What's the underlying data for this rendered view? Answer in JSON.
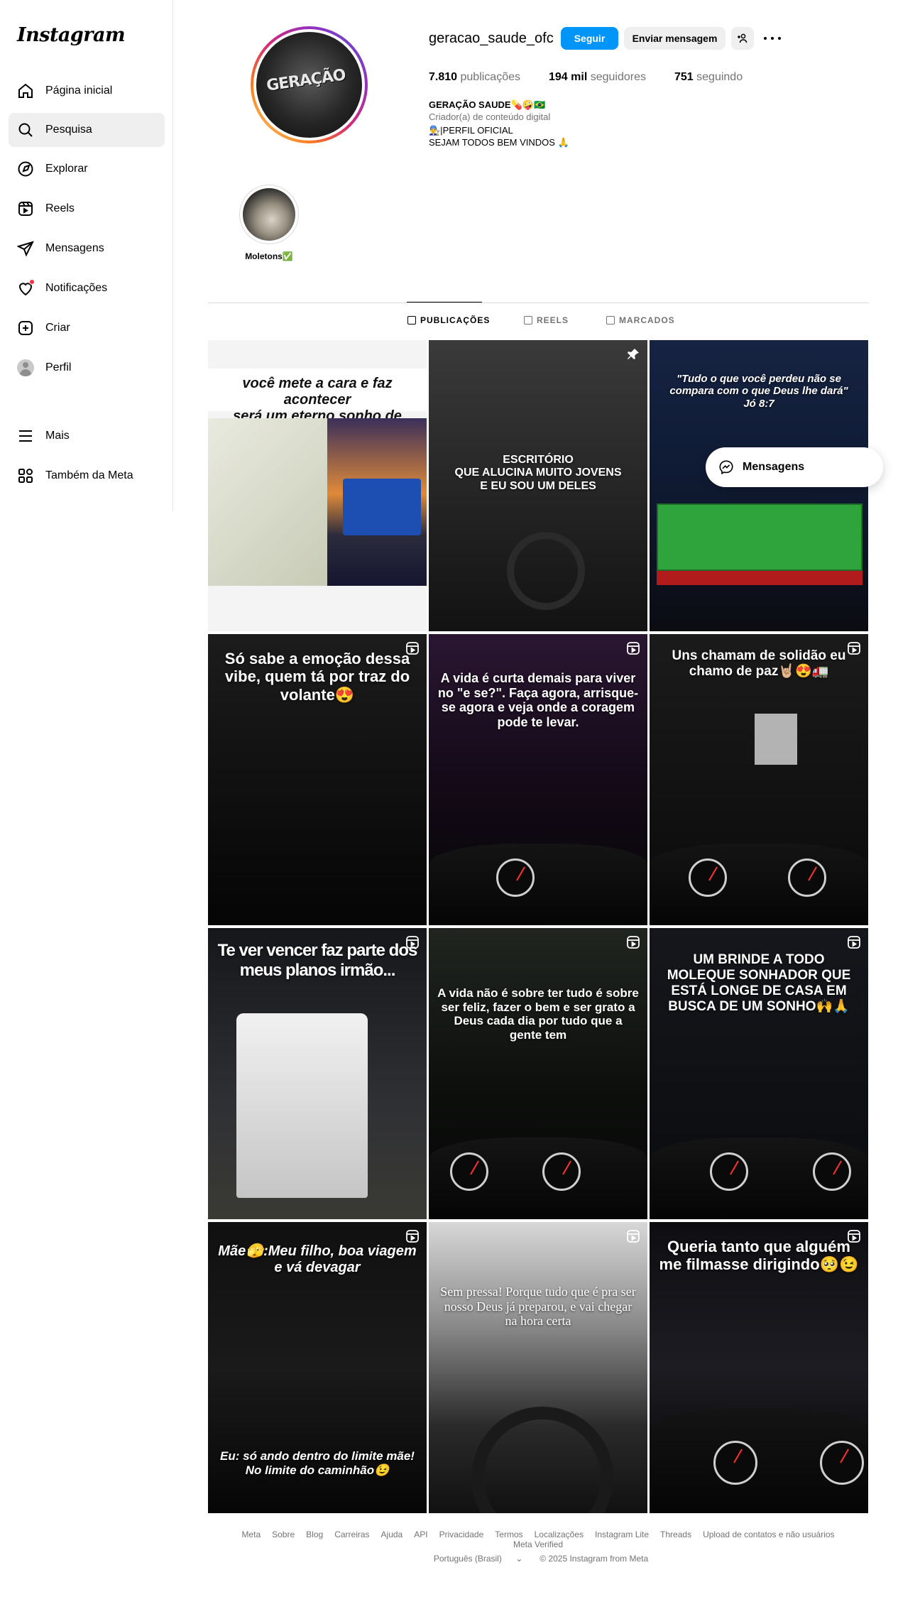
{
  "sidebar": {
    "logo": "Instagram",
    "items": [
      {
        "label": "Página inicial",
        "icon": "home-icon"
      },
      {
        "label": "Pesquisa",
        "icon": "search-icon"
      },
      {
        "label": "Explorar",
        "icon": "compass-icon"
      },
      {
        "label": "Reels",
        "icon": "reels-icon"
      },
      {
        "label": "Mensagens",
        "icon": "send-icon"
      },
      {
        "label": "Notificações",
        "icon": "heart-icon"
      },
      {
        "label": "Criar",
        "icon": "plus-icon"
      },
      {
        "label": "Perfil",
        "icon": "avatar-icon"
      },
      {
        "label": "Mais",
        "icon": "menu-icon"
      },
      {
        "label": "Também da Meta",
        "icon": "meta-apps-icon"
      }
    ]
  },
  "profile": {
    "username": "geracao_saude_ofc",
    "follow_label": "Seguir",
    "message_label": "Enviar mensagem",
    "avatar_text": "GERAÇÃO",
    "stats": {
      "posts_num": "7.810",
      "posts_label": "publicações",
      "followers_num": "194 mil",
      "followers_label": "seguidores",
      "following_num": "751",
      "following_label": "seguindo"
    },
    "bio": {
      "name": "GERAÇÃO SAUDE💊🤪🇧🇷",
      "category": "Criador(a) de conteúdo digital",
      "line1": "👨‍🔧|PERFIL OFICIAL",
      "line2": "SEJAM TODOS BEM VINDOS 🙏"
    }
  },
  "highlight": {
    "label": "Moletons✅"
  },
  "tabs": [
    {
      "label": "PUBLICAÇÕES",
      "icon": "grid-icon",
      "active": true
    },
    {
      "label": "REELS",
      "icon": "reels-icon",
      "active": false
    },
    {
      "label": "MARCADOS",
      "icon": "tagged-icon",
      "active": false
    }
  ],
  "posts": [
    {
      "caption": "você mete a cara e faz acontecer\nserá um eterno sonho de criança",
      "corner": "none"
    },
    {
      "caption": "ESCRITÓRIO\nQUE ALUCINA MUITO JOVENS\nE EU SOU UM DELES",
      "corner": "pin-icon"
    },
    {
      "caption": "\"Tudo o que você perdeu não se compara com o que Deus lhe dará\"\nJó 8:7",
      "corner": "none"
    },
    {
      "caption": "Só sabe a emoção dessa vibe, quem tá por traz do volante😍",
      "corner": "reel-icon"
    },
    {
      "caption": "A vida é curta demais para viver no \"e se?\". Faça agora, arrisque-se agora e veja onde a coragem pode te levar.",
      "corner": "reel-icon"
    },
    {
      "caption": "Uns chamam de solidão eu chamo de paz🤘🏼😍🚛",
      "corner": "reel-icon"
    },
    {
      "caption": "Te ver vencer faz parte dos meus planos irmão...",
      "corner": "reel-icon"
    },
    {
      "caption": "A vida não é sobre ter tudo é sobre ser feliz, fazer o bem e ser grato a Deus cada dia por tudo que a gente tem",
      "corner": "reel-icon"
    },
    {
      "caption": "UM BRINDE A TODO MOLEQUE SONHADOR QUE ESTÁ LONGE DE CASA EM BUSCA DE UM SONHO🙌🙏",
      "corner": "reel-icon"
    },
    {
      "caption": "Mãe🫣:Meu filho, boa viagem e vá devagar",
      "caption2": "Eu: só ando dentro do limite mãe! No limite do caminhão😉",
      "corner": "reel-icon"
    },
    {
      "caption": "Sem pressa! Porque tudo que é pra ser nosso Deus já preparou, e vai chegar na hora certa",
      "corner": "reel-icon"
    },
    {
      "caption": "Queria tanto que alguém me filmasse dirigindo🥺😉",
      "corner": "reel-icon"
    }
  ],
  "messages_pill": {
    "label": "Mensagens"
  },
  "footer": {
    "links": [
      "Meta",
      "Sobre",
      "Blog",
      "Carreiras",
      "Ajuda",
      "API",
      "Privacidade",
      "Termos",
      "Localizações",
      "Instagram Lite",
      "Threads",
      "Upload de contatos e não usuários",
      "Meta Verified"
    ],
    "language": "Português (Brasil)",
    "copyright": "© 2025 Instagram from Meta"
  },
  "colors": {
    "accent": "#0095f6",
    "notification": "#ff3040",
    "muted": "#737373"
  }
}
